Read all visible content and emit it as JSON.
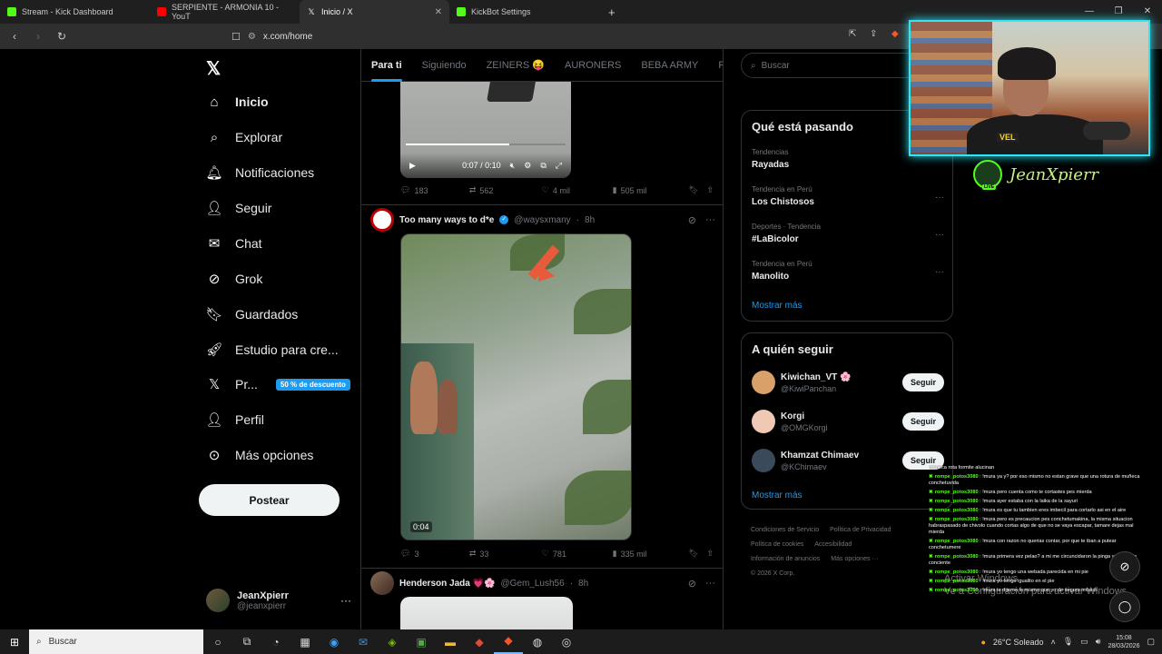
{
  "browser": {
    "tabs": [
      {
        "label": "Stream - Kick Dashboard",
        "color": "#53fc18"
      },
      {
        "label": "SERPIENTE - ARMONIA 10 - YouT",
        "color": "#ff0000"
      },
      {
        "label": "Inicio / X",
        "color": "#ffffff"
      },
      {
        "label": "KickBot Settings",
        "color": "#53fc18"
      }
    ],
    "url": "x.com/home"
  },
  "sidebar": {
    "items": [
      {
        "label": "Inicio",
        "icon": "home-icon"
      },
      {
        "label": "Explorar",
        "icon": "search-icon"
      },
      {
        "label": "Notificaciones",
        "icon": "bell-icon"
      },
      {
        "label": "Seguir",
        "icon": "add-person-icon"
      },
      {
        "label": "Chat",
        "icon": "mail-icon"
      },
      {
        "label": "Grok",
        "icon": "grok-icon"
      },
      {
        "label": "Guardados",
        "icon": "bookmark-icon"
      },
      {
        "label": "Estudio para cre...",
        "icon": "rocket-icon"
      },
      {
        "label": "Pr...",
        "icon": "x-icon"
      },
      {
        "label": "Perfil",
        "icon": "person-icon"
      },
      {
        "label": "Más opciones",
        "icon": "more-circle-icon"
      }
    ],
    "promo_badge": "50 % de descuento",
    "post_button": "Postear",
    "user": {
      "name": "JeanXpierr",
      "handle": "@jeanxpierr"
    }
  },
  "feed": {
    "tabs": [
      "Para ti",
      "Siguiendo",
      "ZEINERS 😝",
      "AURONERS",
      "BEBA ARMY",
      "Fiel Arm"
    ],
    "video1": {
      "time": "0:07 / 0:10",
      "progress": 0.65
    },
    "post1_actions": {
      "replies": "183",
      "reposts": "562",
      "likes": "4 mil",
      "views": "505 mil"
    },
    "post2": {
      "name": "Too many ways to d*e",
      "handle": "@waysxmany",
      "time": "8h",
      "video_time": "0:04",
      "actions": {
        "replies": "3",
        "reposts": "33",
        "likes": "781",
        "views": "335 mil"
      }
    },
    "post3": {
      "name": "Henderson Jada 💗🌸",
      "handle": "@Gem_Lush56",
      "time": "8h"
    }
  },
  "right": {
    "search_placeholder": "Buscar",
    "trends_title": "Qué está pasando",
    "trends": [
      {
        "category": "Tendencias",
        "name": "Rayadas"
      },
      {
        "category": "Tendencia en Perú",
        "name": "Los Chistosos"
      },
      {
        "category": "Deportes · Tendencia",
        "name": "#LaBicolor"
      },
      {
        "category": "Tendencia en Perú",
        "name": "Manolito"
      }
    ],
    "show_more": "Mostrar más",
    "follow_title": "A quién seguir",
    "follow": [
      {
        "name": "Kiwichan_VT 🌸",
        "handle": "@KiwiPanchan",
        "color": "#d9a06a"
      },
      {
        "name": "Korgi",
        "handle": "@OMGKorgi",
        "color": "#f0c9b5"
      },
      {
        "name": "Khamzat Chimaev",
        "handle": "@KChimaev",
        "color": "#3a4a5a"
      }
    ],
    "follow_button": "Seguir",
    "footer": [
      "Condiciones de Servicio",
      "Política de Privacidad",
      "Política de cookies",
      "Accesibilidad",
      "Información de anuncios",
      "Más opciones ···",
      "© 2026 X Corp."
    ]
  },
  "stream": {
    "streamer_name": "JeanXpierr",
    "live_badge": "LIVE",
    "shirt_text": "VEL",
    "chat": [
      {
        "user": "",
        "text": "muñeca rota formite alucinan"
      },
      {
        "user": "rompe_potos3080",
        "text": "!mura ya y? por eso mismo no estan grave que una rotura de muñeca conchetuvida"
      },
      {
        "user": "rompe_potos3080",
        "text": "!mura pero cuenta como te cortastes pes mierda"
      },
      {
        "user": "rompe_potos3080",
        "text": "!mura ayer estaba con la laika de la sayuri"
      },
      {
        "user": "rompe_potos3080",
        "text": "!mura es que tu tambien eres imbecil para cortarlo asi en el aire"
      },
      {
        "user": "rompe_potos3080",
        "text": "!mura pero es precaucion pes conchetumakina, la misma situacion habraspasado de chivolo cuando cortas algo de que no se vaya escapar, tamare dejas mal mierda"
      },
      {
        "user": "rompe_potos3080",
        "text": "!mura con razon no querias contar, por que te iban a putear conchetumere"
      },
      {
        "user": "rompe_potos3080",
        "text": "!mura primera vez pelao? a mi me circuncidaron la pinga yo estando conciente"
      },
      {
        "user": "rompe_potos3080",
        "text": "!mura yo tengo una webada parecida en mi pie"
      },
      {
        "user": "rompe_potos3080",
        "text": "!mura yo tengo igualito en el pie"
      },
      {
        "user": "rompe_potos3080",
        "text": "!mura te dijeron lo mismo que yo de seguro imbecil"
      }
    ],
    "watermark_line1": "Activar Windows",
    "watermark_line2": "Ve a Configuración para activar Windows."
  },
  "taskbar": {
    "search": "Buscar",
    "weather": "26°C  Soleado",
    "time": "15:08",
    "date": "28/03/2026"
  }
}
